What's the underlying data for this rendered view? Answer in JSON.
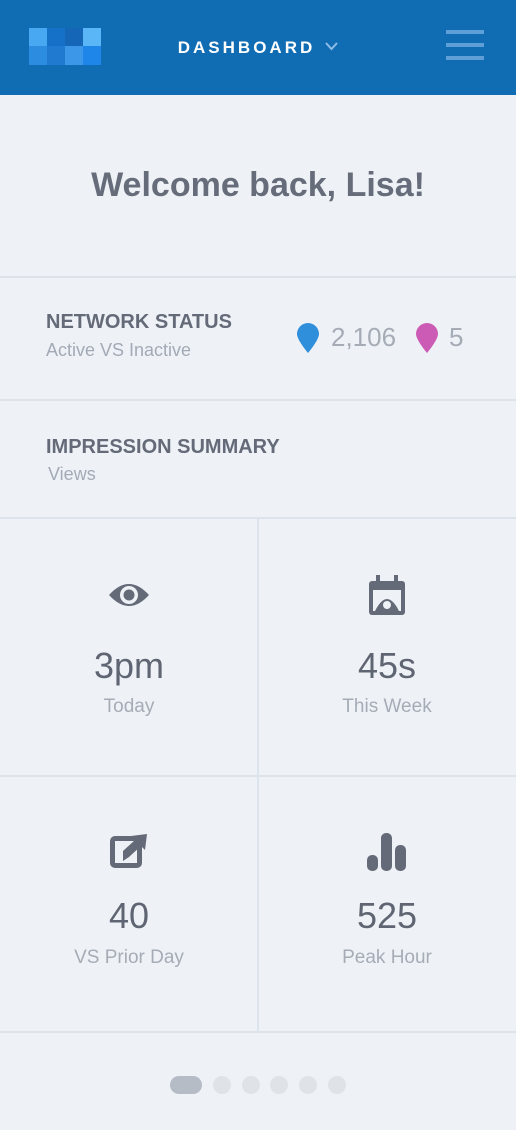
{
  "header": {
    "title": "DASHBOARD",
    "colors": {
      "bar": "#106cb3"
    }
  },
  "welcome": {
    "text": "Welcome back, Lisa!"
  },
  "network_status": {
    "title": "NETWORK STATUS",
    "subtitle": "Active VS Inactive",
    "active": {
      "value": "2,106",
      "color": "#2f8fdb",
      "icon": "map-pin-icon"
    },
    "inactive": {
      "value": "5",
      "color": "#cc5bb5",
      "icon": "map-pin-icon"
    }
  },
  "impression_summary": {
    "title": "IMPRESSION SUMMARY",
    "subtitle": "Views",
    "tiles": [
      {
        "icon": "eye-icon",
        "value": "3pm",
        "label": "Today"
      },
      {
        "icon": "calendar-icon",
        "value": "45s",
        "label": "This Week"
      },
      {
        "icon": "share-icon",
        "value": "40",
        "label": "VS Prior Day"
      },
      {
        "icon": "bar-chart-icon",
        "value": "525",
        "label": "Peak Hour"
      }
    ]
  },
  "pager": {
    "pages": 6,
    "current": 1
  }
}
